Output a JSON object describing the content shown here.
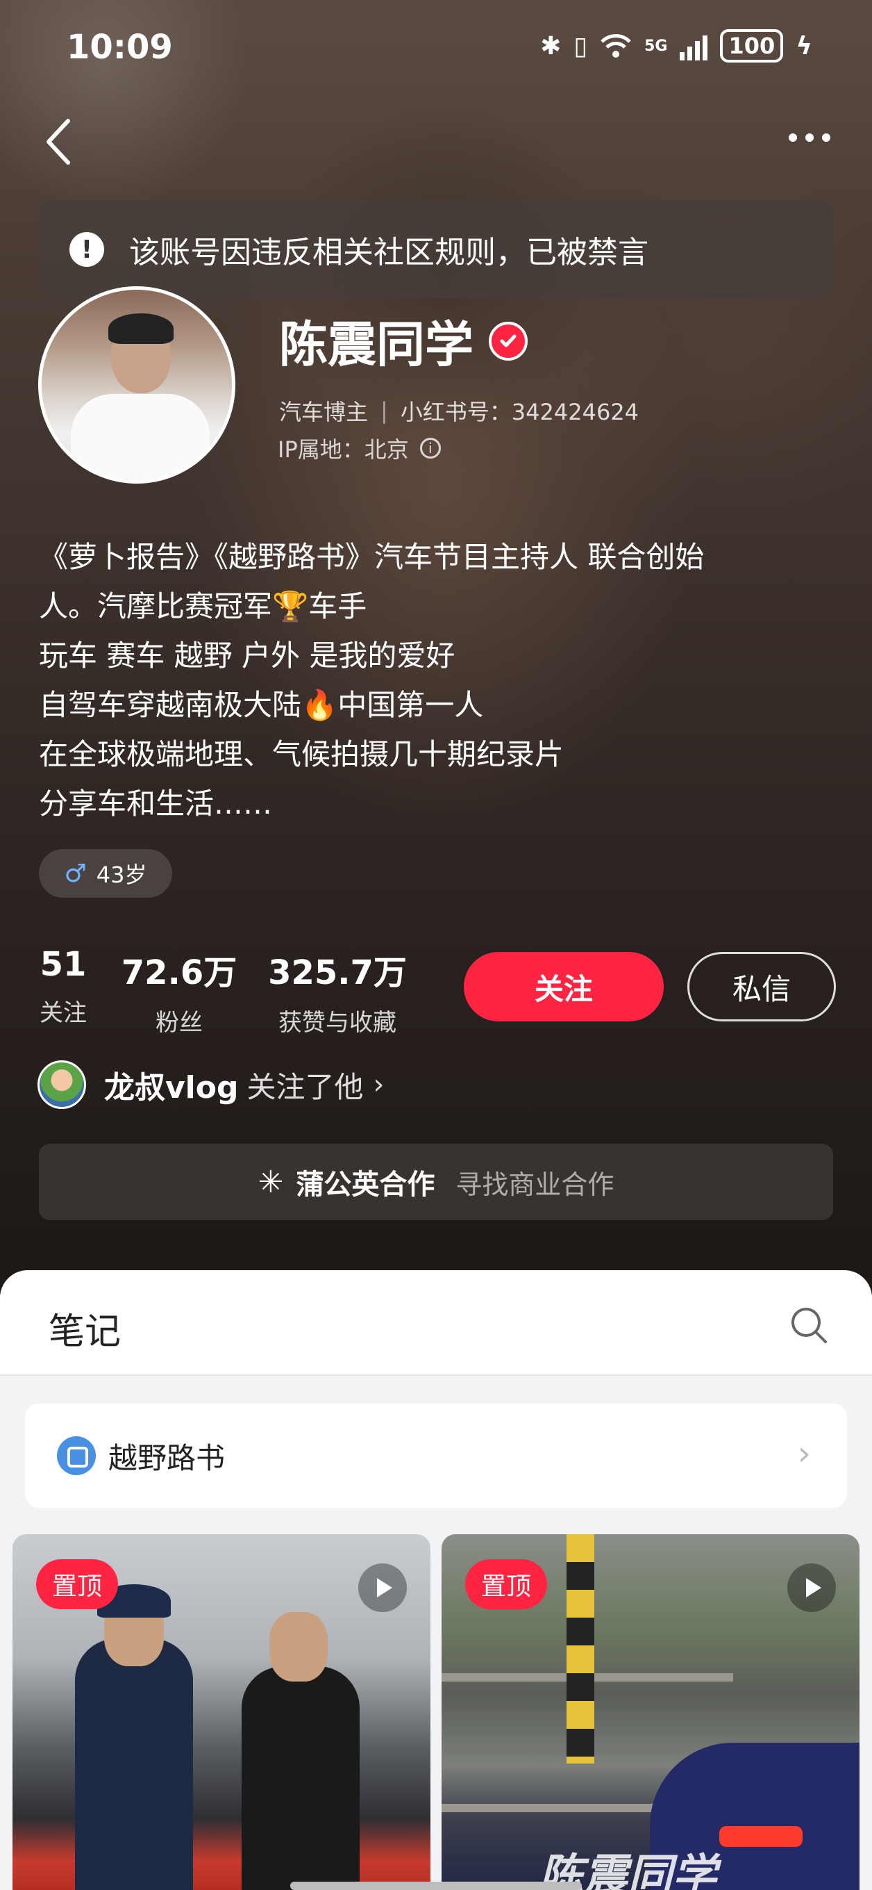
{
  "status_bar": {
    "time": "10:09",
    "battery": "100",
    "network": "5G"
  },
  "nav": {
    "back_icon": "chevron-left-icon",
    "more_icon": "more-horizontal-icon"
  },
  "ban_notice": {
    "icon": "alert-circle-icon",
    "text": "该账号因违反相关社区规则，已被禁言"
  },
  "profile": {
    "name": "陈震同学",
    "verified_icon": "verified-check-icon",
    "tag": "汽车博主",
    "separator": "|",
    "id_label": "小红书号：342424624",
    "ip_label": "IP属地：北京",
    "info_icon": "info-icon"
  },
  "bio": {
    "lines": [
      "《萝卜报告》《越野路书》汽车节目主持人 联合创始",
      "人。汽摩比赛冠军🏆车手",
      "玩车 赛车 越野 户外 是我的爱好",
      "自驾车穿越南极大陆🔥中国第一人",
      "在全球极端地理、气候拍摄几十期纪录片",
      "分享车和生活……"
    ]
  },
  "age_tag": {
    "icon": "male-icon",
    "label": "43岁"
  },
  "stats": [
    {
      "value": "51",
      "label": "关注"
    },
    {
      "value": "72.6万",
      "label": "粉丝"
    },
    {
      "value": "325.7万",
      "label": "获赞与收藏"
    }
  ],
  "actions": {
    "follow": "关注",
    "message": "私信"
  },
  "mutual": {
    "name": "龙叔vlog",
    "text": "关注了他",
    "chevron": "›"
  },
  "dandelion": {
    "icon": "dandelion-icon",
    "title": "蒲公英合作",
    "subtitle": "寻找商业合作"
  },
  "content": {
    "tab": "笔记",
    "search_icon": "search-icon",
    "collection": {
      "icon": "collection-icon",
      "title": "越野路书",
      "chevron": "›"
    },
    "posts": [
      {
        "badge": "置顶",
        "type": "video"
      },
      {
        "badge": "置顶",
        "type": "video",
        "watermark": "陈震同学"
      }
    ]
  },
  "colors": {
    "accent": "#ff2442",
    "collection_icon": "#4a90e2"
  }
}
